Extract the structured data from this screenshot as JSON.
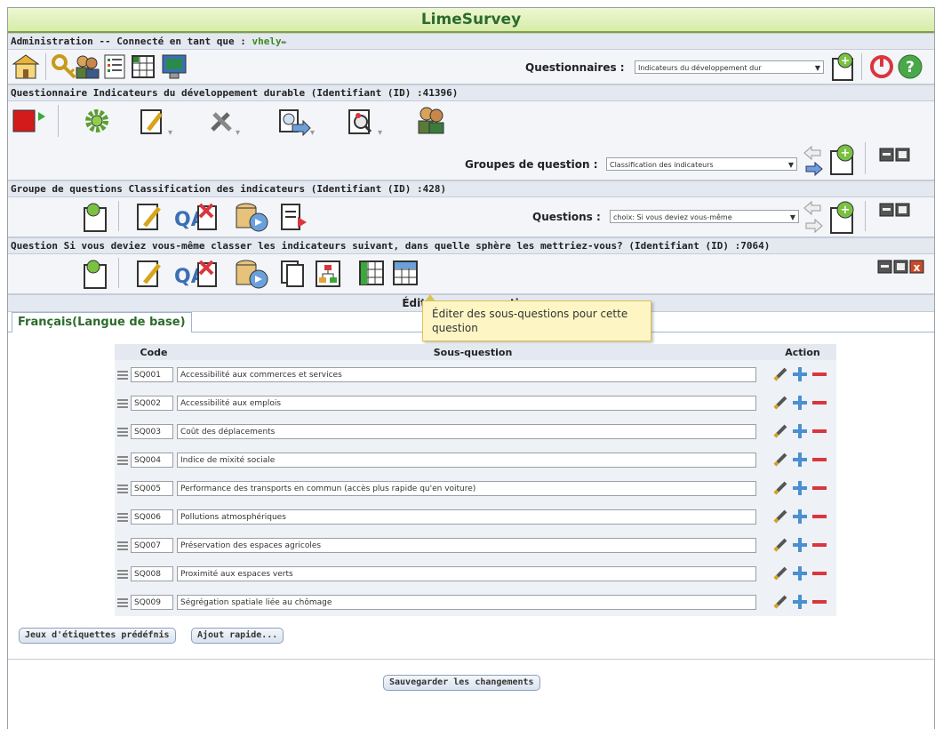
{
  "app": {
    "title": "LimeSurvey"
  },
  "admin_bar": {
    "prefix": "Administration -- Connecté en tant que : ",
    "username": "vhely",
    "surveys_label": "Questionnaires :",
    "surveys_select": "Indicateurs du développement dur"
  },
  "survey_bar": {
    "title": "Questionnaire Indicateurs du développement durable (Identifiant (ID) :41396)",
    "groups_label": "Groupes de question :",
    "groups_select": "Classification des indicateurs"
  },
  "group_bar": {
    "title": "Groupe de questions Classification des indicateurs (Identifiant (ID) :428)",
    "questions_label": "Questions :",
    "questions_select": "choix: Si vous deviez vous-même"
  },
  "question_bar": {
    "title": "Question Si vous deviez vous-même classer les indicateurs suivant, dans quelle sphère les mettriez-vous? (Identifiant (ID) :7064)"
  },
  "editor": {
    "title": "Éditer",
    "title_rest": "questions",
    "tooltip": "Éditer des sous-questions pour cette question",
    "language_tab": "Français(Langue de base)",
    "columns": {
      "code": "Code",
      "subquestion": "Sous-question",
      "action": "Action"
    },
    "rows": [
      {
        "code": "SQ001",
        "text": "Accessibilité aux commerces et services"
      },
      {
        "code": "SQ002",
        "text": "Accessibilité aux emplois"
      },
      {
        "code": "SQ003",
        "text": "Coût des déplacements"
      },
      {
        "code": "SQ004",
        "text": "Indice de mixité sociale"
      },
      {
        "code": "SQ005",
        "text": "Performance des transports en commun (accès plus rapide qu'en voiture)"
      },
      {
        "code": "SQ006",
        "text": "Pollutions atmosphériques"
      },
      {
        "code": "SQ007",
        "text": "Préservation des espaces agricoles"
      },
      {
        "code": "SQ008",
        "text": "Proximité aux espaces verts"
      },
      {
        "code": "SQ009",
        "text": "Ségrégation spatiale liée au chômage"
      }
    ],
    "predefined_label_sets_button": "Jeux d'étiquettes prédéfnis",
    "quick_add_button": "Ajout rapide...",
    "save_button": "Sauvegarder les changements"
  },
  "colors": {
    "brand_green": "#2d6b2d",
    "header_bar": "#e4e9f1",
    "tooltip_bg": "#fdf6c4",
    "delete_red": "#d9363e",
    "add_blue": "#4a8fd1"
  }
}
